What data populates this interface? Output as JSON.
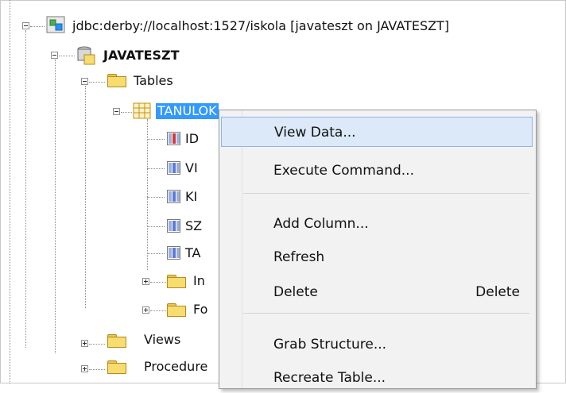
{
  "tree": {
    "connection": "jdbc:derby://localhost:1527/iskola [javateszt on JAVATESZT]",
    "schema": "JAVATESZT",
    "tables_folder": "Tables",
    "selected_table": "TANULOK",
    "columns": [
      {
        "label": "ID",
        "pk": true
      },
      {
        "label": "VI",
        "pk": false
      },
      {
        "label": "KI",
        "pk": false
      },
      {
        "label": "SZ",
        "pk": false
      },
      {
        "label": "TA",
        "pk": false
      }
    ],
    "subfolders": [
      "In",
      "Fo"
    ],
    "views_folder": "Views",
    "procedures_folder": "Procedure"
  },
  "context_menu": {
    "items": [
      {
        "label": "View Data...",
        "shortcut": ""
      },
      {
        "label": "Execute Command...",
        "shortcut": ""
      },
      {
        "label": "Add Column...",
        "shortcut": ""
      },
      {
        "label": "Refresh",
        "shortcut": ""
      },
      {
        "label": "Delete",
        "shortcut": "Delete"
      },
      {
        "label": "Grab Structure...",
        "shortcut": ""
      },
      {
        "label": "Recreate Table...",
        "shortcut": ""
      }
    ]
  }
}
